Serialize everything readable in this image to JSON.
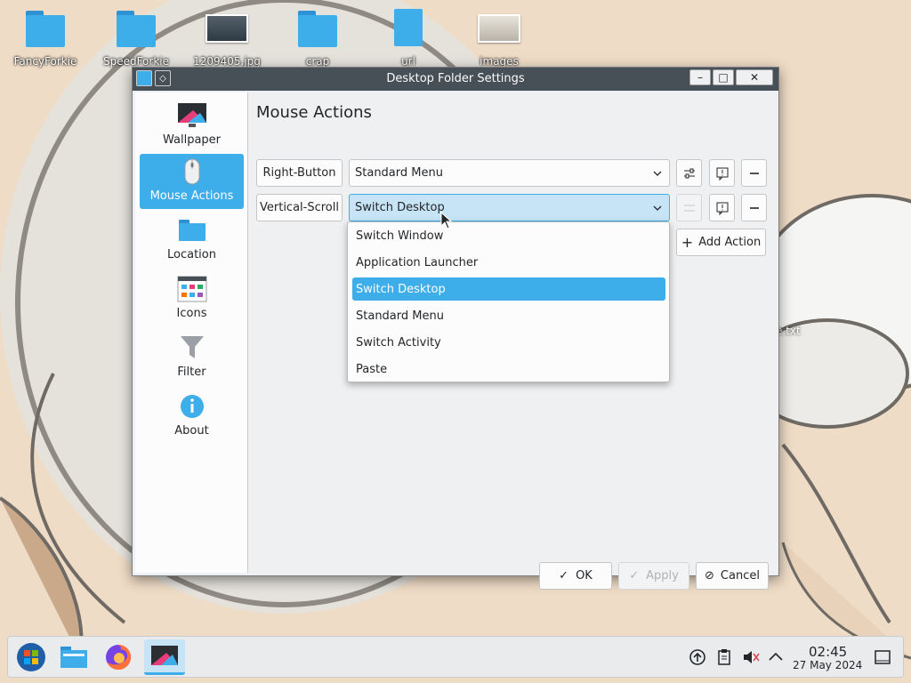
{
  "desktop": {
    "icons": [
      {
        "label": "FancyForkie",
        "icon": "folder-icon"
      },
      {
        "label": "SpeedForkie",
        "icon": "folder-icon"
      },
      {
        "label": "1209405.jpg",
        "icon": "image-icon"
      },
      {
        "label": "crap",
        "icon": "folder-icon"
      },
      {
        "label": "url",
        "icon": "web-document-icon"
      },
      {
        "label": "images",
        "icon": "image-icon"
      }
    ],
    "partial_label": "e.txt"
  },
  "window": {
    "title": "Desktop Folder Settings",
    "controls": {
      "minimize": "minimize-icon",
      "maximize": "maximize-icon",
      "close": "close-icon"
    }
  },
  "sidebar": {
    "items": [
      {
        "label": "Wallpaper",
        "icon": "wallpaper-icon",
        "active": false
      },
      {
        "label": "Mouse Actions",
        "icon": "mouse-icon",
        "active": true
      },
      {
        "label": "Location",
        "icon": "folder-icon",
        "active": false
      },
      {
        "label": "Icons",
        "icon": "icons-grid-icon",
        "active": false
      },
      {
        "label": "Filter",
        "icon": "filter-icon",
        "active": false
      },
      {
        "label": "About",
        "icon": "info-icon",
        "active": false
      }
    ]
  },
  "main": {
    "title": "Mouse Actions",
    "actions": [
      {
        "trigger": "Right-Button",
        "value": "Standard Menu"
      },
      {
        "trigger": "Vertical-Scroll",
        "value": "Switch Desktop"
      }
    ],
    "add_action": "Add Action",
    "dropdown_options": [
      {
        "label": "Switch Window",
        "selected": false
      },
      {
        "label": "Application Launcher",
        "selected": false
      },
      {
        "label": "Switch Desktop",
        "selected": true
      },
      {
        "label": "Standard Menu",
        "selected": false
      },
      {
        "label": "Switch Activity",
        "selected": false
      },
      {
        "label": "Paste",
        "selected": false
      }
    ]
  },
  "footer": {
    "ok": "OK",
    "apply": "Apply",
    "cancel": "Cancel"
  },
  "taskbar": {
    "time": "02:45",
    "date": "27 May 2024"
  },
  "colors": {
    "accent": "#3daee9",
    "titlebar": "#475057",
    "window_bg": "#eff0f1"
  }
}
